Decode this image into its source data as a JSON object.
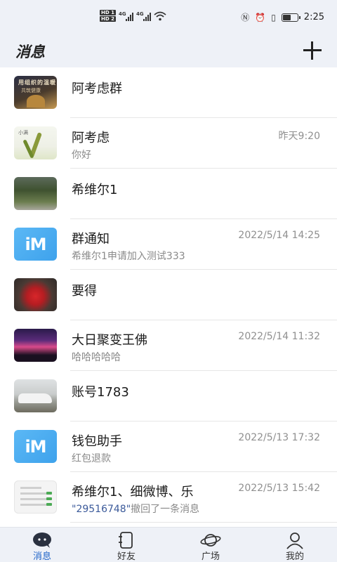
{
  "status_bar": {
    "hd1": "HD 1",
    "hd2": "HD 2",
    "net1": "4G",
    "net2": "4G",
    "time": "2:25"
  },
  "header": {
    "title": "消息"
  },
  "conversations": [
    {
      "name": "阿考虑群",
      "time": "",
      "preview": "",
      "avatar": "poster"
    },
    {
      "name": "阿考虑",
      "time": "昨天9:20",
      "preview": "你好",
      "avatar": "grain"
    },
    {
      "name": "希维尔1",
      "time": "",
      "preview": "",
      "avatar": "forest"
    },
    {
      "name": "群通知",
      "time": "2022/5/14 14:25",
      "preview": "希维尔1申请加入测试333",
      "avatar": "im"
    },
    {
      "name": "要得",
      "time": "",
      "preview": "",
      "avatar": "toy"
    },
    {
      "name": "大日聚变王佛",
      "time": "2022/5/14 11:32",
      "preview": "哈哈哈哈哈",
      "avatar": "concert"
    },
    {
      "name": "账号1783",
      "time": "",
      "preview": "",
      "avatar": "car"
    },
    {
      "name": "钱包助手",
      "time": "2022/5/13 17:32",
      "preview": "红包退款",
      "avatar": "im"
    },
    {
      "name": "希维尔1、细微博、乐",
      "time": "2022/5/13 15:42",
      "preview_highlight": "\"29516748\"",
      "preview": "撤回了一条消息",
      "avatar": "screenshot"
    }
  ],
  "avatar_text": {
    "im": "iM"
  },
  "tabs": [
    {
      "label": "消息",
      "icon": "message-bubble-icon",
      "active": true
    },
    {
      "label": "好友",
      "icon": "contacts-book-icon",
      "active": false
    },
    {
      "label": "广场",
      "icon": "planet-icon",
      "active": false
    },
    {
      "label": "我的",
      "icon": "profile-icon",
      "active": false
    }
  ],
  "colors": {
    "accent": "#1e63c8",
    "header_bg": "#eef1f7",
    "im_avatar": "#4aaaf0"
  }
}
